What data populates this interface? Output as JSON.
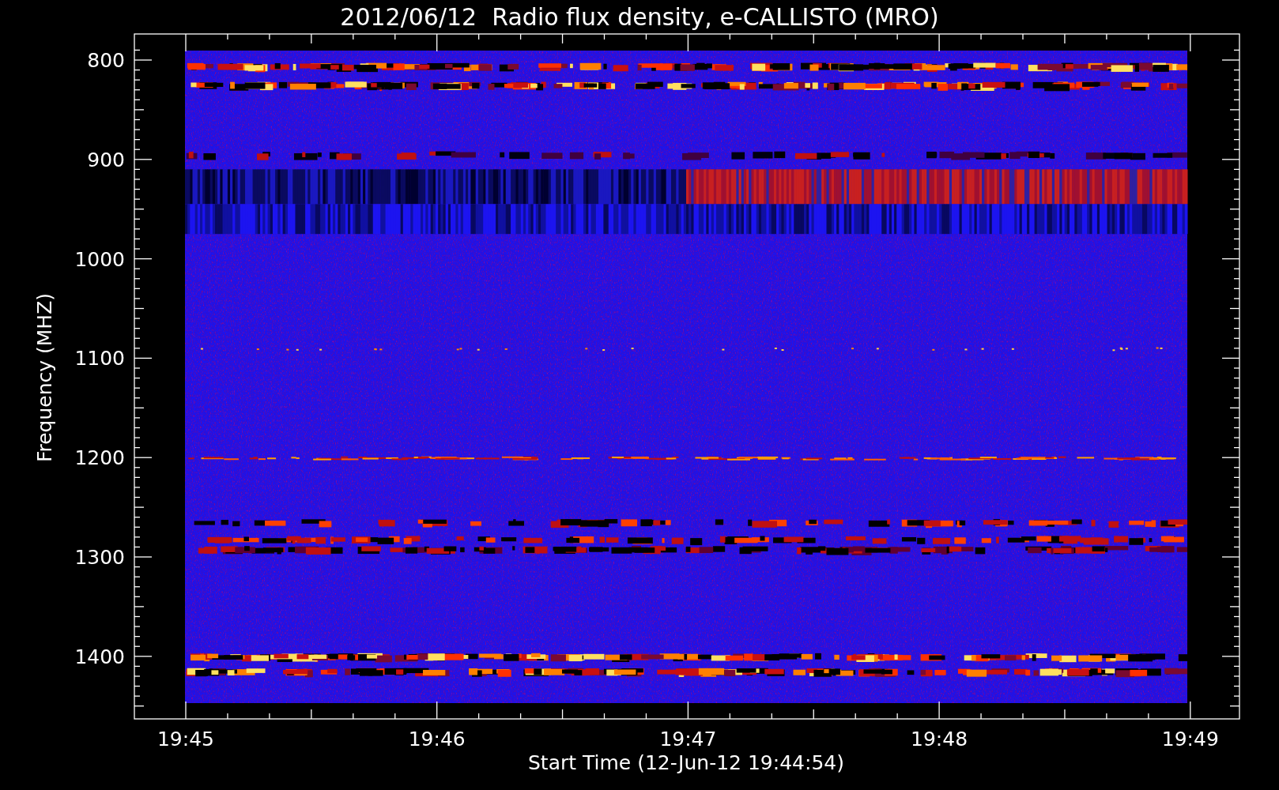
{
  "title": "2012/06/12  Radio flux density, e-CALLISTO (MRO)",
  "ylabel": "Frequency (MHZ)",
  "xlabel": "Start Time (12-Jun-12 19:44:54)",
  "yticks": [
    "800",
    "900",
    "1000",
    "1100",
    "1200",
    "1300",
    "1400"
  ],
  "xticks": [
    "19:45",
    "19:46",
    "19:47",
    "19:48",
    "19:49"
  ]
}
